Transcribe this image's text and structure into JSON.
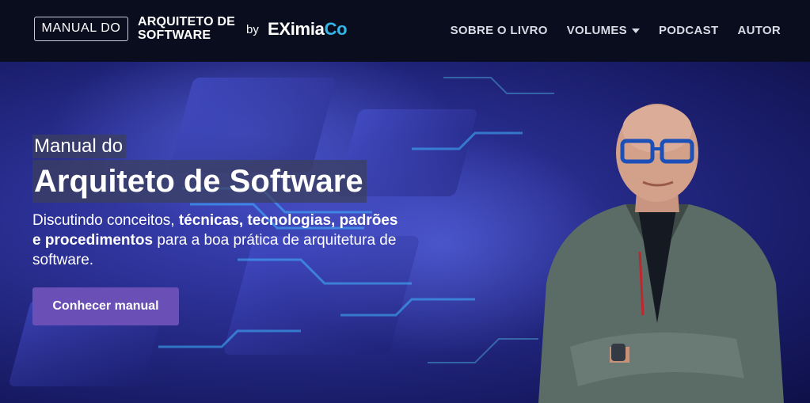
{
  "header": {
    "brand_box": "MANUAL DO",
    "brand_title_line1": "ARQUITETO DE",
    "brand_title_line2": "SOFTWARE",
    "by": "by",
    "eximia_main": "EXimia",
    "eximia_co": "Co",
    "nav": [
      {
        "label": "SOBRE O LIVRO"
      },
      {
        "label": "VOLUMES",
        "icon": "caret-down-icon"
      },
      {
        "label": "PODCAST"
      },
      {
        "label": "AUTOR"
      }
    ]
  },
  "hero": {
    "eyebrow": "Manual do",
    "headline": "Arquiteto de Software",
    "subtitle_part1": "Discutindo conceitos, ",
    "subtitle_bold": "técnicas, tecnologias, padrões e procedimentos",
    "subtitle_part2": " para a boa prática de arquitetura de software.",
    "cta": "Conhecer manual"
  },
  "colors": {
    "header_bg": "#0a0d1e",
    "accent_button": "#6a50b6",
    "eximia_co": "#33b6e8",
    "hero_bg": "#2a2f92"
  }
}
